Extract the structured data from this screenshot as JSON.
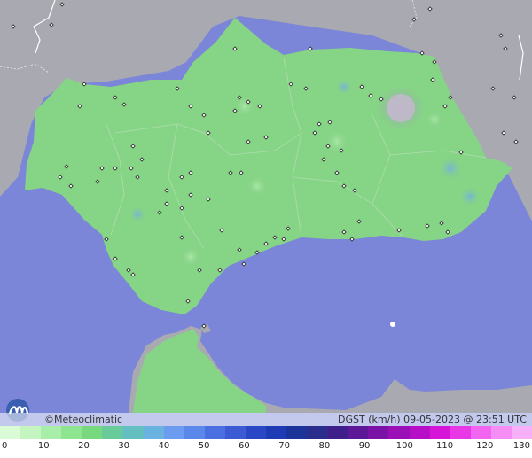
{
  "footer": {
    "brand": "©Meteoclimatic",
    "info": "DGST (km/h)   09-05-2023 @ 23:51 UTC"
  },
  "scale": {
    "ticks": [
      "0",
      "10",
      "20",
      "30",
      "40",
      "50",
      "60",
      "70",
      "80",
      "90",
      "100",
      "110",
      "120",
      "130"
    ],
    "colors": [
      "#d9fbd6",
      "#c4f5c1",
      "#a8eea8",
      "#8fe58f",
      "#78d87e",
      "#6acb9a",
      "#63bfc0",
      "#6ab3e1",
      "#6b9cf0",
      "#5b86ea",
      "#4b6fe1",
      "#3b5ad4",
      "#2a47c5",
      "#1e3ab4",
      "#1c3399",
      "#2a2d8c",
      "#3f1f8a",
      "#5d1898",
      "#7b12a6",
      "#9a0fb6",
      "#b70fc8",
      "#d615d8",
      "#e838e6",
      "#f165f0",
      "#f48df4",
      "#f7b0f7"
    ]
  },
  "map_colors": {
    "sea": "#7b86d8",
    "land_other": "#a8a8b0",
    "andalusia": "#86d486",
    "station": "#ffffff"
  }
}
